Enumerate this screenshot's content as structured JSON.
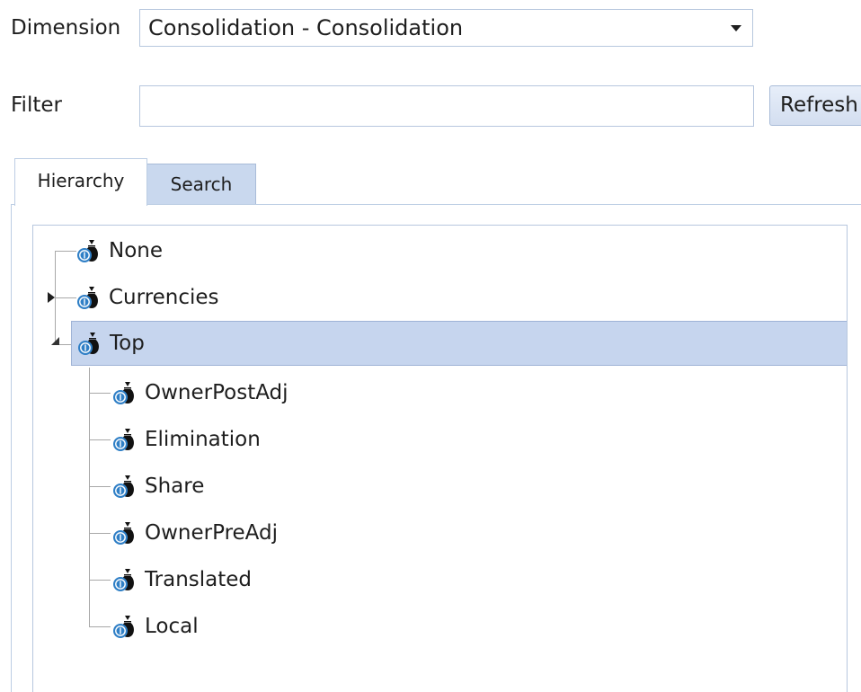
{
  "form": {
    "dimension_label": "Dimension",
    "dimension_value": "Consolidation - Consolidation",
    "filter_label": "Filter",
    "filter_value": "",
    "refresh_label": "Refresh"
  },
  "tabs": [
    {
      "label": "Hierarchy",
      "active": true
    },
    {
      "label": "Search",
      "active": false
    }
  ],
  "tree": {
    "root_nodes": [
      {
        "label": "None",
        "icon": "member-money-bag-icon",
        "expander": "none"
      },
      {
        "label": "Currencies",
        "icon": "member-money-bag-icon",
        "expander": "collapsed"
      },
      {
        "label": "Top",
        "icon": "member-money-bag-icon",
        "expander": "expanded",
        "selected": true
      }
    ],
    "top_children": [
      {
        "label": "OwnerPostAdj",
        "icon": "member-money-bag-icon"
      },
      {
        "label": "Elimination",
        "icon": "member-money-bag-icon"
      },
      {
        "label": "Share",
        "icon": "member-money-bag-icon"
      },
      {
        "label": "OwnerPreAdj",
        "icon": "member-money-bag-icon"
      },
      {
        "label": "Translated",
        "icon": "member-money-bag-icon"
      },
      {
        "label": "Local",
        "icon": "member-money-bag-icon"
      }
    ]
  },
  "colors": {
    "selection": "#c6d5ee",
    "tab_inactive": "#c9d8ee",
    "border": "#b7c7de",
    "icon_blue": "#2f7fc6"
  }
}
